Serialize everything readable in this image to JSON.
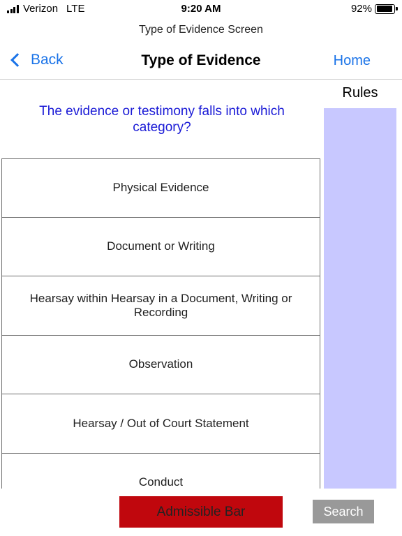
{
  "status_bar": {
    "carrier": "Verizon",
    "network": "LTE",
    "time": "9:20 AM",
    "battery_percent": "92%",
    "battery_level": 0.92
  },
  "screen_caption": "Type of Evidence Screen",
  "nav": {
    "back_label": "Back",
    "title": "Type of Evidence",
    "home_label": "Home"
  },
  "rules_panel": {
    "label": "Rules",
    "color": "#c8c8ff"
  },
  "question": "The evidence or testimony falls into which category?",
  "categories": [
    {
      "label": "Physical Evidence"
    },
    {
      "label": "Document or Writing"
    },
    {
      "label": "Hearsay within Hearsay in a Document, Writing or Recording"
    },
    {
      "label": "Observation"
    },
    {
      "label": "Hearsay / Out of Court Statement"
    },
    {
      "label": "Conduct"
    }
  ],
  "buttons": {
    "admissible_label": "Admissible Bar",
    "search_label": "Search"
  },
  "colors": {
    "link_blue": "#1a73e8",
    "question_blue": "#1a1ad6",
    "admissible_red": "#c0070d",
    "search_gray": "#999999"
  }
}
